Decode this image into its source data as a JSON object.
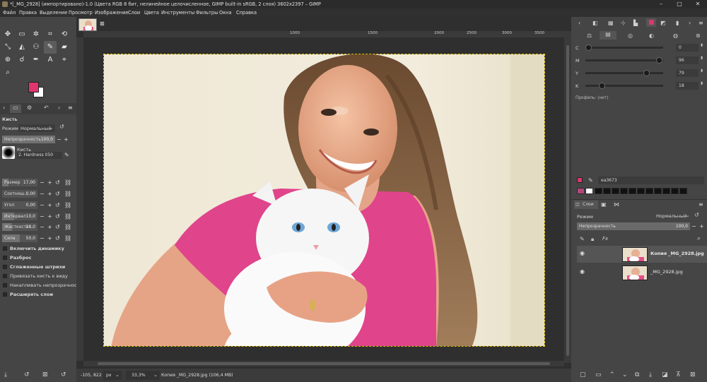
{
  "window": {
    "title": "*[_MG_2928] (импортировано)-1.0 (Цвета RGB 8 бит, нелинейное целочисленное, GIMP built-in sRGB, 2 слоя) 3602x2397 – GIMP"
  },
  "menu": [
    "Файл",
    "Правка",
    "Выделение",
    "Просмотр",
    "Изображение",
    "Слои",
    "Цвета",
    "Инструменты",
    "Фильтры",
    "Окна",
    "Справка"
  ],
  "colors": {
    "fg": "#e0356f",
    "bg": "#ffffff"
  },
  "tool_options": {
    "title": "Кисть",
    "mode_label": "Режим",
    "mode_value": "Нормальный",
    "opacity_label": "Непрозрачность",
    "opacity_value": "100,0",
    "brush_label": "Кисть",
    "brush_name": "2. Hardness 050",
    "sliders": [
      {
        "name": "Размер",
        "value": "17,00",
        "fill": 0.17
      },
      {
        "name": "Соотнош...",
        "value": "0,00",
        "fill": 0.0
      },
      {
        "name": "Угол",
        "value": "0,00",
        "fill": 0.0
      },
      {
        "name": "Интервал",
        "value": "10,0",
        "fill": 0.33
      },
      {
        "name": "Жесткость",
        "value": "28,0",
        "fill": 0.28
      },
      {
        "name": "Сила",
        "value": "50,0",
        "fill": 0.5
      }
    ],
    "options": [
      "Включить динамику",
      "Разброс",
      "Сглаженные штрихи",
      "Привязать кисть к виду",
      "Накапливать непрозрачность",
      "Расширять слои"
    ]
  },
  "ruler": {
    "ticks": [
      "1000",
      "1500",
      "2000",
      "2500",
      "3000",
      "3500"
    ]
  },
  "status": {
    "coords": "-105, 822",
    "unit": "px",
    "zoom": "33,3%",
    "info": "Копия _MG_2928.jpg (106,4 MB)"
  },
  "cmyk": [
    {
      "label": "C",
      "value": "0",
      "fill": 0.0
    },
    {
      "label": "M",
      "value": "96",
      "fill": 0.96
    },
    {
      "label": "Y",
      "value": "79",
      "fill": 0.79
    },
    {
      "label": "K",
      "value": "18",
      "fill": 0.18
    }
  ],
  "profile": "Профиль: (нет)",
  "hex": "ea3673",
  "layers_tab": "Слои",
  "layers": {
    "mode_label": "Режим",
    "mode_value": "Нормальный",
    "opacity_label": "Непрозрачность",
    "opacity_value": "100,0",
    "items": [
      "Копия _MG_2928.jpg",
      "_MG_2928.jpg"
    ]
  }
}
